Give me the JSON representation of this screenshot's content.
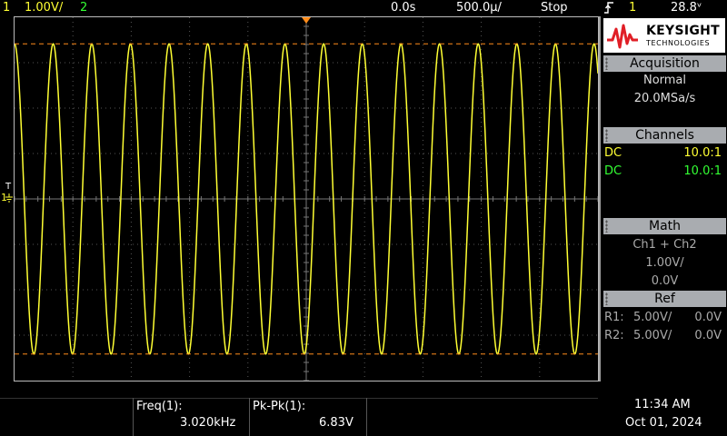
{
  "colors": {
    "ch1": "#ffff33",
    "ch2": "#33ff33",
    "trigger": "#ff8c1a",
    "panel_header": "#a9acb0",
    "grid": "#555555"
  },
  "top_bar": {
    "ch1_number": "1",
    "ch1_scale": "1.00V/",
    "ch2_number": "2",
    "time_delay": "0.0s",
    "time_scale": "500.0µ/",
    "run_state": "Stop",
    "trigger_edge_icon": "rising-edge-icon",
    "trigger_source": "1",
    "trigger_level": "28.8ᵛ"
  },
  "side_panel": {
    "brand": "KEYSIGHT",
    "brand_sub": "TECHNOLOGIES",
    "acquisition": {
      "title": "Acquisition",
      "mode": "Normal",
      "rate": "20.0MSa/s"
    },
    "channels": {
      "title": "Channels",
      "rows": [
        {
          "coupling": "DC",
          "probe": "10.0:1",
          "color": "#ffff33"
        },
        {
          "coupling": "DC",
          "probe": "10.0:1",
          "color": "#33ff33"
        }
      ]
    },
    "math": {
      "title": "Math",
      "function": "Ch1 + Ch2",
      "scale": "1.00V/",
      "offset": "0.0V"
    },
    "ref": {
      "title": "Ref",
      "rows": [
        {
          "label": "R1:",
          "scale": "5.00V/",
          "offset": "0.0V"
        },
        {
          "label": "R2:",
          "scale": "5.00V/",
          "offset": "0.0V"
        }
      ]
    }
  },
  "measurements": [
    {
      "label": "Freq(1):",
      "value": "3.020kHz"
    },
    {
      "label": "Pk-Pk(1):",
      "value": "6.83V"
    }
  ],
  "clock": {
    "time": "11:34 AM",
    "date": "Oct 01, 2024"
  },
  "graticule": {
    "ground_marker": "1",
    "trigger_marker": "T"
  },
  "waveform": {
    "frequency_hz": 3020,
    "time_per_div_s": 0.0005,
    "volts_per_div": 1.0,
    "pk_pk_v": 6.83,
    "h_divs": 10,
    "v_divs": 8,
    "start_phase_deg": 90
  }
}
